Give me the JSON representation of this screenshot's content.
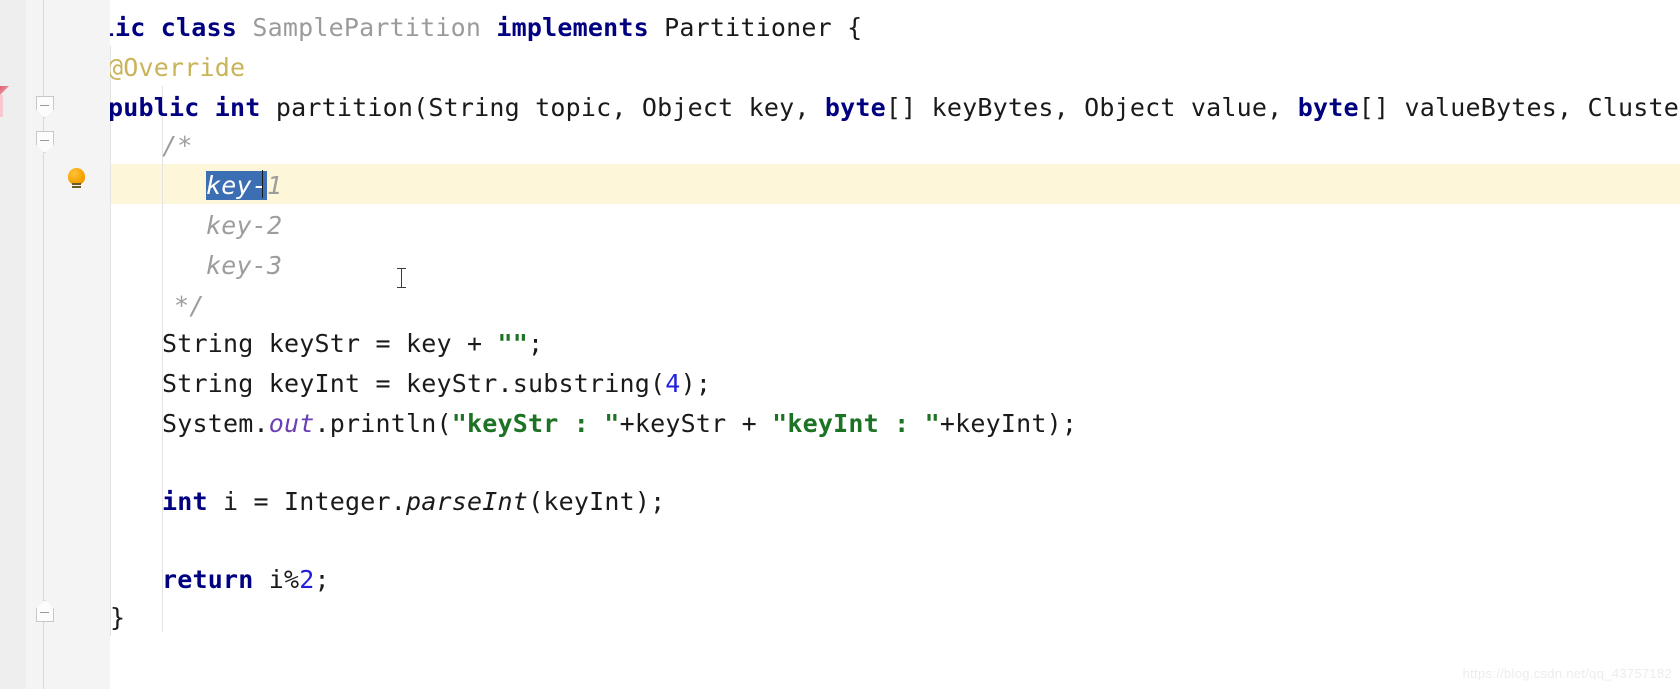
{
  "editor": {
    "language": "Java",
    "class_signature": {
      "kw_public": "public",
      "kw_class": "class",
      "class_name": "SamplePartition",
      "kw_implements": "implements",
      "interface_name": "Partitioner",
      "brace": "{"
    },
    "annotation": "@Override",
    "method_signature": {
      "kw_public": "public",
      "kw_int": "int",
      "name": "partition(",
      "p1": "String topic, Object key, ",
      "kw_byte1": "byte",
      "p2": "[] keyBytes, Object value, ",
      "kw_byte2": "byte",
      "p3": "[] valueBytes, Cluster cluste"
    },
    "comment_block": {
      "open": "/*",
      "line1_selected": "key-",
      "line1_rest": "1",
      "line2": "key-2",
      "line3": "key-3",
      "close": "*/"
    },
    "statements": {
      "keystr_decl_pre": "String keyStr = key + ",
      "keystr_decl_str": "\"\"",
      "keystr_decl_post": ";",
      "keyint_decl_pre": "String keyInt = keyStr.substring(",
      "keyint_decl_num": "4",
      "keyint_decl_post": ");",
      "println_sys": "System.",
      "println_out": "out",
      "println_call": ".println(",
      "println_str1": "\"keyStr : \"",
      "println_mid1": "+keyStr + ",
      "println_str2": "\"keyInt : \"",
      "println_mid2": "+keyInt);",
      "parse_kw": "int",
      "parse_mid": " i = Integer.",
      "parse_method": "parseInt",
      "parse_post": "(keyInt);",
      "return_kw": "return",
      "return_expr": " i%",
      "return_num": "2",
      "return_semi": ";",
      "close_brace": "}"
    },
    "gutter": {
      "fold_marker_1": "fold-collapse-marker",
      "fold_marker_2": "fold-collapse-marker",
      "fold_marker_3": "fold-expand-marker",
      "intention_bulb": "lightbulb-icon",
      "error_stripe": "error-stripe-marker"
    },
    "watermark": "https://blog.csdn.net/qq_43757182",
    "colors": {
      "keyword": "#000080",
      "string": "#1d7324",
      "number": "#2020dd",
      "comment": "#9d9d9d",
      "annotation": "#c9b458",
      "selection": "#3c6eb4",
      "caret_line": "#fdf6d8",
      "static_field": "#6a3fb5",
      "gutter_bg": "#f4f4f4"
    }
  }
}
